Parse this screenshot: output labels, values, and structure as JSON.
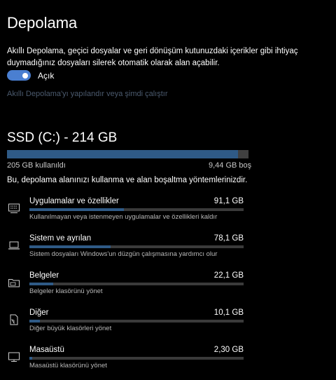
{
  "page": {
    "title": "Depolama",
    "description": "Akıllı Depolama, geçici dosyalar ve geri dönüşüm kutunuzdaki içerikler gibi ihtiyaç duymadığınız dosyaları silerek otomatik olarak alan açabilir.",
    "toggle_label": "Açık",
    "toggle_on": true,
    "configure_link": "Akıllı Depolama'yı yapılandır veya şimdi çalıştır"
  },
  "drive": {
    "title": "SSD (C:) - 214 GB",
    "used_label": "205 GB kullanıldı",
    "free_label": "9,44 GB boş",
    "used_fraction": 0.956
  },
  "categories_intro": "Bu, depolama alanınızı kullanma ve alan boşaltma yöntemlerinizdir.",
  "categories": [
    {
      "name": "Uygulamalar ve özellikler",
      "size": "91,1 GB",
      "note": "Kullanılmayan veya istenmeyen uygulamalar ve özellikleri kaldır",
      "icon": "apps-monitor-icon",
      "fraction": 0.44
    },
    {
      "name": "Sistem ve ayrılan",
      "size": "78,1 GB",
      "note": "Sistem dosyaları Windows'un düzgün çalışmasına yardımcı olur",
      "icon": "laptop-icon",
      "fraction": 0.38
    },
    {
      "name": "Belgeler",
      "size": "22,1 GB",
      "note": "Belgeler klasörünü yönet",
      "icon": "folder-icon",
      "fraction": 0.11
    },
    {
      "name": "Diğer",
      "size": "10,1 GB",
      "note": "Diğer büyük klasörleri yönet",
      "icon": "document-icon",
      "fraction": 0.05
    },
    {
      "name": "Masaüstü",
      "size": "2,30 GB",
      "note": "Masaüstü klasörünü yönet",
      "icon": "monitor-icon",
      "fraction": 0.012
    }
  ],
  "colors": {
    "accent": "#4a7fd1",
    "bar_fill": "#2f5a86",
    "bar_track": "#3a3a3a",
    "link": "#4b5a6e"
  }
}
